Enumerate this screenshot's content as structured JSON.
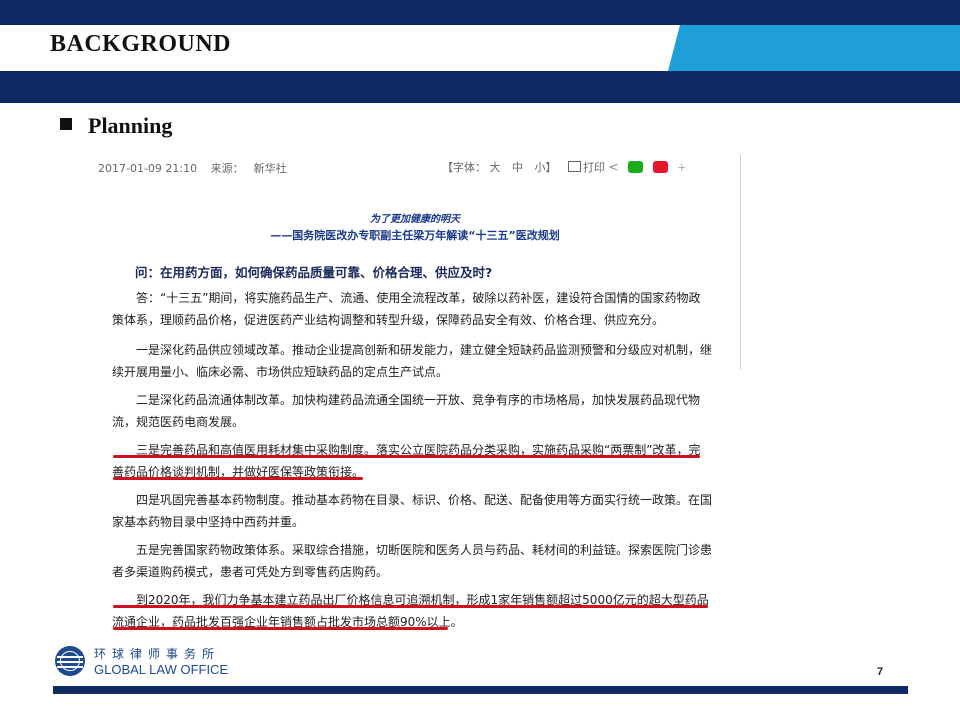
{
  "slide": {
    "title": "BACKGROUND",
    "section": "Planning",
    "page_number": "7"
  },
  "colors": {
    "navy": "#0e2a62",
    "accent_blue": "#1e9fd8",
    "highlight_red": "#d10f1f"
  },
  "article": {
    "date": "2017-01-09 21:10",
    "source_label": "来源：",
    "source": "新华社",
    "font_size_label": "【字体：",
    "font_large": "大",
    "font_medium": "中",
    "font_small": "小】",
    "print_label": "打印",
    "headline_sub": "为了更加健康的明天",
    "headline_main": "——国务院医改办专职副主任梁万年解读“十三五”医改规划",
    "question": "问：在用药方面，如何确保药品质量可靠、价格合理、供应及时?",
    "paragraphs": [
      "答：“十三五”期间，将实施药品生产、流通、使用全流程改革，破除以药补医，建设符合国情的国家药物政策体系，理顺药品价格，促进医药产业结构调整和转型升级，保障药品安全有效、价格合理、供应充分。",
      "一是深化药品供应领域改革。推动企业提高创新和研发能力，建立健全短缺药品监测预警和分级应对机制，继续开展用量小、临床必需、市场供应短缺药品的定点生产试点。",
      "二是深化药品流通体制改革。加快构建药品流通全国统一开放、竞争有序的市场格局，加快发展药品现代物流，规范医药电商发展。",
      "三是完善药品和高值医用耗材集中采购制度。落实公立医院药品分类采购，实施药品采购“两票制”改革，完善药品价格谈判机制，并做好医保等政策衔接。",
      "四是巩固完善基本药物制度。推动基本药物在目录、标识、价格、配送、配备使用等方面实行统一政策。在国家基本药物目录中坚持中西药并重。",
      "五是完善国家药物政策体系。采取综合措施，切断医院和医务人员与药品、耗材间的利益链。探索医院门诊患者多渠道购药模式，患者可凭处方到零售药店购药。",
      "到2020年，我们力争基本建立药品出厂价格信息可追溯机制，形成1家年销售额超过5000亿元的超大型药品流通企业，药品批发百强企业年销售额占批发市场总额90%以上。"
    ]
  },
  "footer": {
    "org_cn": "环球律师事务所",
    "org_en": "GLOBAL LAW OFFICE"
  }
}
